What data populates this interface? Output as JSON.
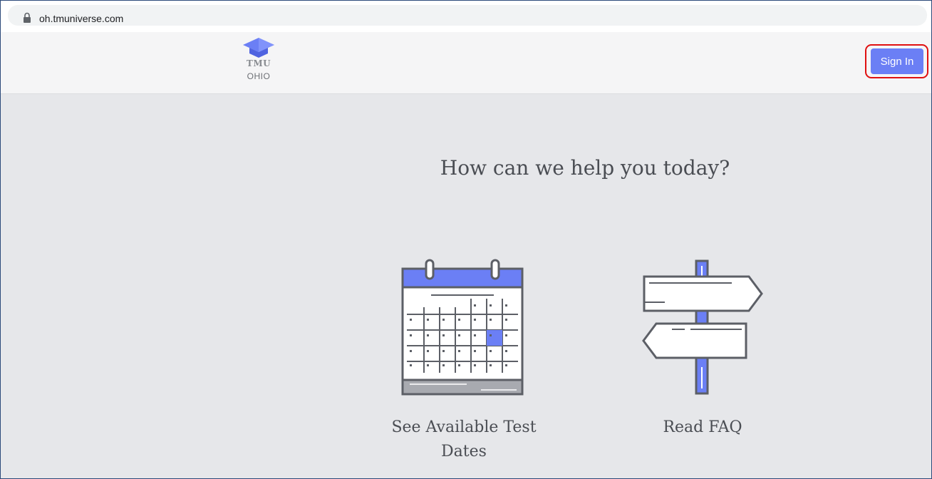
{
  "browser": {
    "url": "oh.tmuniverse.com"
  },
  "header": {
    "logo_title": "TMU",
    "logo_subtitle": "OHIO",
    "signin_label": "Sign In"
  },
  "main": {
    "heading": "How can we help you today?",
    "cards": [
      {
        "label": "See Available Test Dates",
        "icon": "calendar-icon"
      },
      {
        "label": "Read FAQ",
        "icon": "signpost-icon"
      }
    ]
  },
  "colors": {
    "accent": "#6b7ff5",
    "background": "#e6e7ea",
    "text": "#4a4d53",
    "highlight_border": "#e01010"
  }
}
